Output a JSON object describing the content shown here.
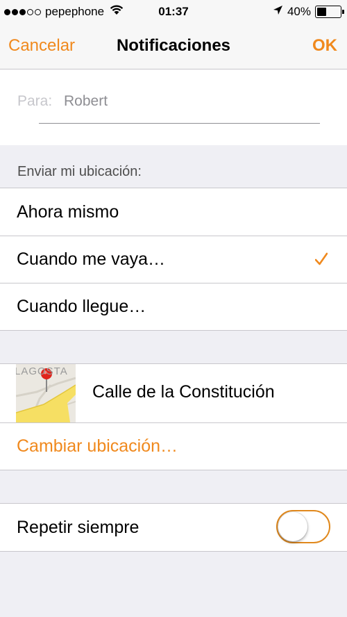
{
  "status_bar": {
    "carrier": "pepephone",
    "time": "01:37",
    "battery_percent": "40%",
    "battery_level": 0.4,
    "icons": [
      "signal-dots-icon",
      "wifi-icon",
      "location-arrow-icon",
      "battery-icon"
    ]
  },
  "nav": {
    "cancel": "Cancelar",
    "title": "Notificaciones",
    "ok": "OK"
  },
  "to": {
    "label": "Para:",
    "value": "Robert"
  },
  "send_location": {
    "header": "Enviar mi ubicación:",
    "options": [
      {
        "label": "Ahora mismo",
        "selected": false
      },
      {
        "label": "Cuando me vaya…",
        "selected": true
      },
      {
        "label": "Cuando llegue…",
        "selected": false
      }
    ]
  },
  "location": {
    "map_text": "LAGOSTA",
    "address": "Calle de la Constitución",
    "change": "Cambiar ubicación…"
  },
  "repeat": {
    "label": "Repetir siempre",
    "enabled": false
  },
  "colors": {
    "accent": "#f0891d",
    "background": "#efeff4"
  }
}
